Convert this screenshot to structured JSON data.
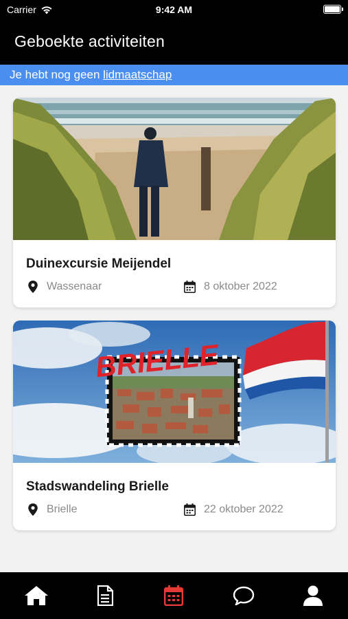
{
  "status_bar": {
    "carrier": "Carrier",
    "time": "9:42 AM"
  },
  "header": {
    "title": "Geboekte activiteiten"
  },
  "membership": {
    "text": "Je hebt nog geen ",
    "link": "lidmaatschap"
  },
  "activities": [
    {
      "title": "Duinexcursie Meijendel",
      "location": "Wassenaar",
      "date": "8 oktober 2022"
    },
    {
      "title": "Stadswandeling Brielle",
      "location": "Brielle",
      "date": "22 oktober 2022",
      "image_text": "BRIELLE"
    }
  ],
  "tab_bar": {
    "items": [
      {
        "icon": "home-icon",
        "active": false
      },
      {
        "icon": "document-icon",
        "active": false
      },
      {
        "icon": "calendar-icon",
        "active": true
      },
      {
        "icon": "chat-icon",
        "active": false
      },
      {
        "icon": "user-icon",
        "active": false
      }
    ],
    "active_color": "#e53935",
    "inactive_color": "#ffffff"
  },
  "colors": {
    "accent": "#4a8ff0",
    "header_bg": "#000000"
  }
}
